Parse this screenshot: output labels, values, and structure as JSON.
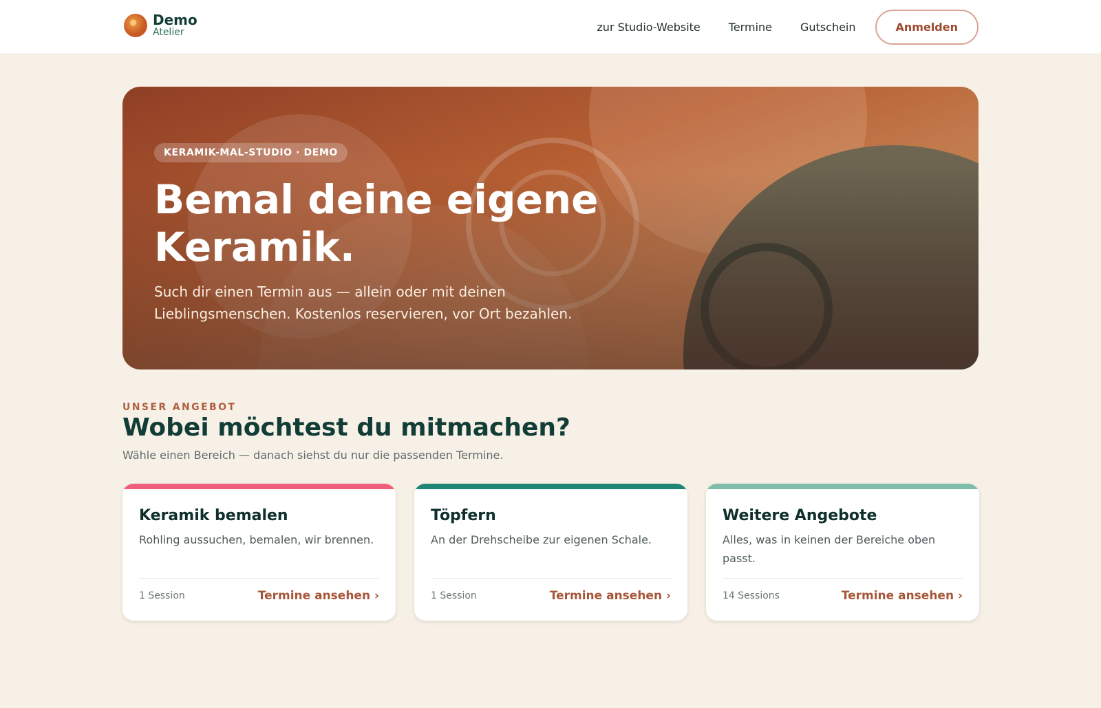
{
  "brand": {
    "name": "Demo",
    "sub": "Atelier"
  },
  "nav": {
    "links": [
      "zur Studio-Website",
      "Termine",
      "Gutschein"
    ],
    "login_label": "Anmelden"
  },
  "hero": {
    "badge": "KERAMIK-MAL-STUDIO · DEMO",
    "title": "Bemal deine eigene Keramik.",
    "subtitle": "Such dir einen Termin aus — allein oder mit deinen Lieblingsmenschen. Kostenlos reservieren, vor Ort bezahlen."
  },
  "section": {
    "eyebrow": "UNSER ANGEBOT",
    "title": "Wobei möchtest du mitmachen?",
    "subtitle": "Wähle einen Bereich — danach siehst du nur die passenden Termine."
  },
  "cards": [
    {
      "title": "Keramik bemalen",
      "description": "Rohling aussuchen, bemalen, wir brennen.",
      "count": "1 Session",
      "link": "Termine ansehen ›",
      "accent": "#ef5f7b"
    },
    {
      "title": "Töpfern",
      "description": "An der Drehscheibe zur eigenen Schale.",
      "count": "1 Session",
      "link": "Termine ansehen ›",
      "accent": "#1f8473"
    },
    {
      "title": "Weitere Angebote",
      "description": "Alles, was in keinen der Bereiche oben passt.",
      "count": "14 Sessions",
      "link": "Termine ansehen ›",
      "accent": "#7fbcaa"
    }
  ],
  "colors": {
    "background": "#f7f0e7",
    "brand_dark": "#123d36",
    "accent_terracotta": "#a65638"
  }
}
